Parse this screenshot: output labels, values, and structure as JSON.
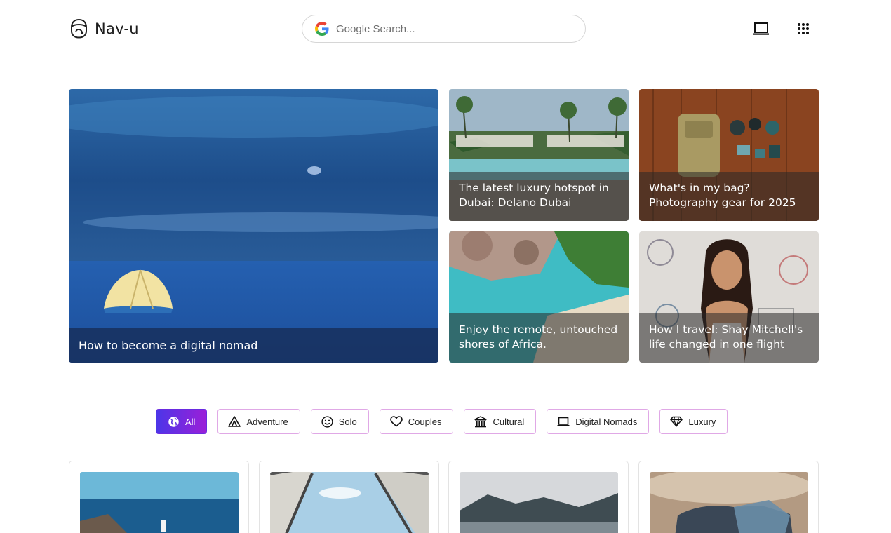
{
  "header": {
    "logo_text": "Nav-u",
    "search_placeholder": "Google Search...",
    "icons": [
      "face-logo-icon",
      "google-g-icon",
      "laptop-icon",
      "apps-grid-icon"
    ]
  },
  "hero": {
    "featured": {
      "title": "How to become a digital nomad"
    },
    "cards": [
      {
        "title_line1": "The latest luxury hotspot in",
        "title_line2": "Dubai: Delano Dubai"
      },
      {
        "title_line1": "What's in my bag?",
        "title_line2": "Photography gear for 2025"
      },
      {
        "title_line1": "Enjoy the remote, untouched",
        "title_line2": "shores of Africa."
      },
      {
        "title_line1": "How I travel: Shay Mitchell's",
        "title_line2": "life changed in one flight"
      }
    ]
  },
  "filters": [
    {
      "label": "All",
      "icon": "globe-icon",
      "active": true
    },
    {
      "label": "Adventure",
      "icon": "tent-icon"
    },
    {
      "label": "Solo",
      "icon": "smiley-icon"
    },
    {
      "label": "Couples",
      "icon": "heart-icon"
    },
    {
      "label": "Cultural",
      "icon": "museum-icon"
    },
    {
      "label": "Digital Nomads",
      "icon": "laptop-icon"
    },
    {
      "label": "Luxury",
      "icon": "diamond-icon"
    }
  ],
  "colors": {
    "accent_start": "#4c36e8",
    "accent_end": "#9b1fd8",
    "chip_border": "#e0a8e6"
  }
}
